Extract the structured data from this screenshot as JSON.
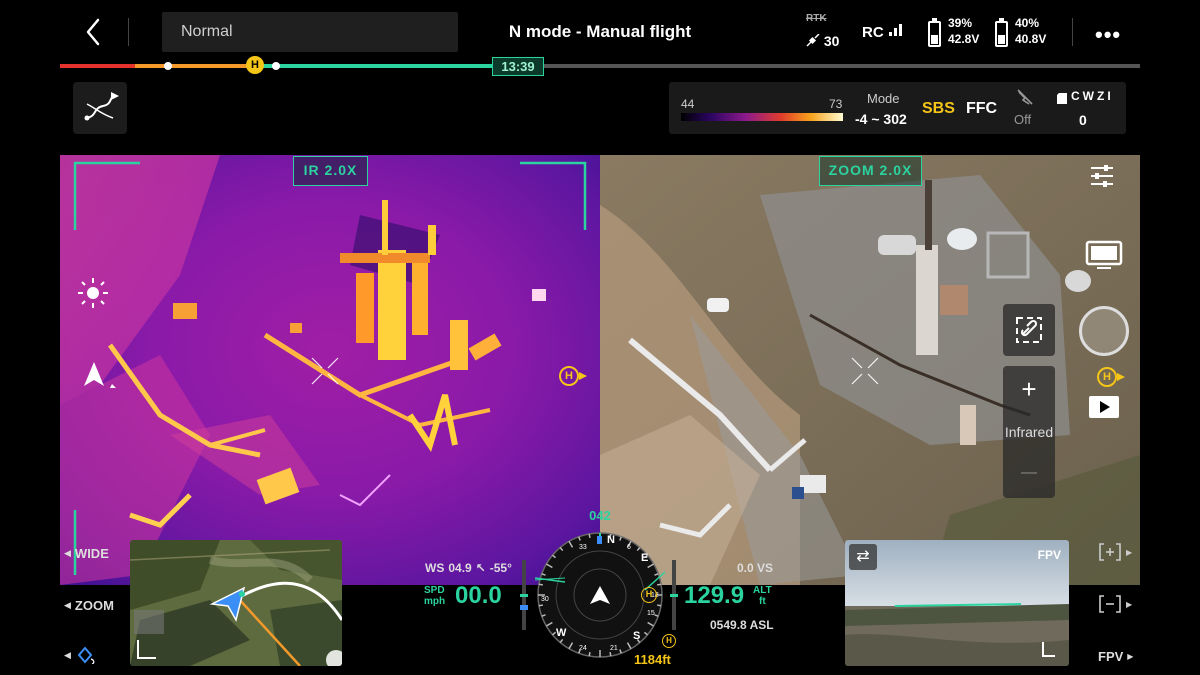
{
  "header": {
    "back_icon": "chevron-left-icon",
    "flight_mode_selector": "Normal",
    "title": "N mode - Manual flight",
    "rtk_label": "RTK",
    "satellite_count": "30",
    "rc_label": "RC",
    "rc_signal_bars": 3,
    "battery_left": {
      "percent": "39%",
      "voltage": "42.8V",
      "level": 0.39
    },
    "battery_right": {
      "percent": "40%",
      "voltage": "40.8V",
      "level": 0.4
    },
    "more_label": "•••"
  },
  "timeline": {
    "flight_time": "13:39",
    "home_marker": "H",
    "progress": 0.405,
    "colors": {
      "red": "#e5322d",
      "orange": "#f39a2b",
      "green": "#2bd39f",
      "track": "#555555"
    }
  },
  "thermal_panel": {
    "min_temp": "44",
    "max_temp": "73",
    "mode_label": "Mode",
    "mode_range": "-4 ~ 302",
    "sbs_label": "SBS",
    "ffc_label": "FFC",
    "off_label": "Off",
    "cwzi_label": "CWZI",
    "cwzi_value": "0"
  },
  "views": {
    "ir_tag": "IR 2.0X",
    "zoom_tag": "ZOOM 2.0X",
    "home_marker": "H",
    "infrared_label": "Infrared",
    "zoom_plus": "+",
    "zoom_minus": "—"
  },
  "left_controls": {
    "wide_label": "WIDE",
    "zoom_label": "ZOOM"
  },
  "flight_data": {
    "ws_label": "WS",
    "ws_value": "04.9",
    "wind_dir": "-55°",
    "spd_label": "SPD",
    "spd_unit": "mph",
    "speed": "00.0",
    "heading": "042",
    "vs_value": "0.0 VS",
    "alt_label": "ALT",
    "alt_unit": "ft",
    "altitude": "129.9",
    "asl_value": "0549.8 ASL",
    "home_distance": "1184ft"
  },
  "compass": {
    "n": "N",
    "e": "E",
    "s": "S",
    "w": "W",
    "ticks": [
      "6",
      "12",
      "15",
      "21",
      "24",
      "30",
      "33"
    ]
  },
  "right_controls": {
    "fpv_label": "FPV",
    "fpv_nav_label": "FPV"
  },
  "accent_colors": {
    "hud_green": "#2bd39f",
    "home_yellow": "#f5c518"
  }
}
